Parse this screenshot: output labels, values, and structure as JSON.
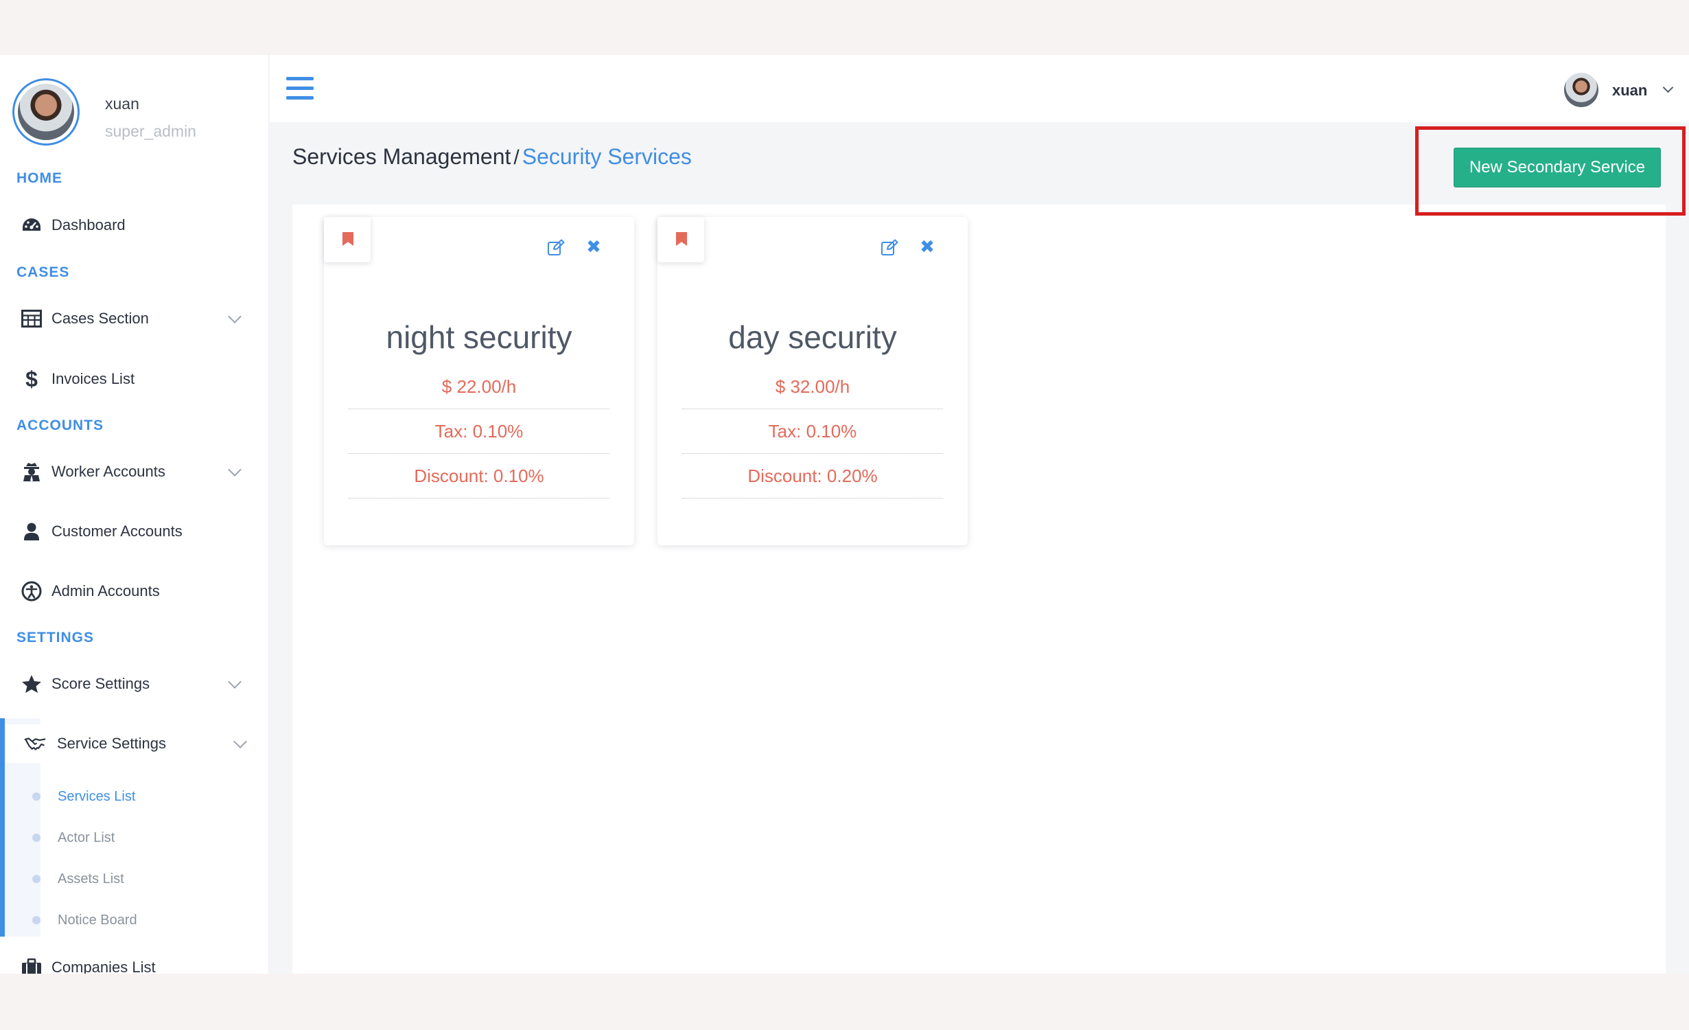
{
  "profile": {
    "name": "xuan",
    "role": "super_admin"
  },
  "sidebar": {
    "sections": {
      "home": "HOME",
      "cases": "CASES",
      "accounts": "ACCOUNTS",
      "settings": "SETTINGS"
    },
    "items": {
      "dashboard": "Dashboard",
      "cases_section": "Cases Section",
      "invoices_list": "Invoices List",
      "worker_accounts": "Worker Accounts",
      "customer_accounts": "Customer Accounts",
      "admin_accounts": "Admin Accounts",
      "score_settings": "Score Settings",
      "service_settings": "Service Settings",
      "companies_list": "Companies List"
    },
    "service_submenu": [
      {
        "label": "Services List",
        "active": true
      },
      {
        "label": "Actor List",
        "active": false
      },
      {
        "label": "Assets List",
        "active": false
      },
      {
        "label": "Notice Board",
        "active": false
      }
    ]
  },
  "topbar": {
    "user_name": "xuan"
  },
  "breadcrumb": {
    "parent": "Services Management",
    "separator": "/",
    "current": "Security Services"
  },
  "actions": {
    "new_button": "New Secondary Service"
  },
  "services": [
    {
      "name": "night security",
      "price": "$ 22.00/h",
      "tax": "Tax: 0.10%",
      "discount": "Discount: 0.10%"
    },
    {
      "name": "day security",
      "price": "$ 32.00/h",
      "tax": "Tax: 0.10%",
      "discount": "Discount: 0.20%"
    }
  ],
  "colors": {
    "accent": "#3f8ee5",
    "button": "#26b08a",
    "price_text": "#e46a5a",
    "highlight": "#d61f1f"
  },
  "icons": {
    "dashboard": "tachometer-icon",
    "cases": "table-icon",
    "invoices": "dollar-icon",
    "worker": "user-secret-icon",
    "customer": "user-icon",
    "admin": "universal-access-icon",
    "score": "star-icon",
    "service": "handshake-icon",
    "companies": "briefcase-icon"
  }
}
